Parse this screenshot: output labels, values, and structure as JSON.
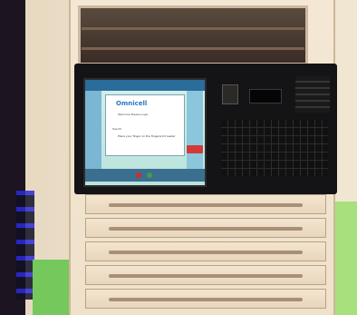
{
  "image": {
    "subject": "medication-dispensing-cabinet",
    "kiosk_screen": {
      "logo_text": "Omnicell",
      "dialog_line1": "Welcome Please Login",
      "dialog_line2": "Use ID",
      "dialog_line3": "Place your finger on the fingerprint reader"
    }
  },
  "colors": {
    "screen_accent": "#2a6c9a",
    "logo_blue": "#2a77c8",
    "alert_red": "#d23a3a"
  }
}
